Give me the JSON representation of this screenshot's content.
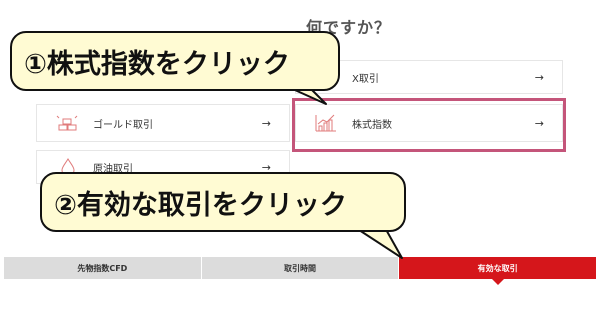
{
  "question": {
    "visible_text": "何ですか？"
  },
  "cards": [
    {
      "key": "fx",
      "label": "X取引",
      "arrow": "→",
      "icon": "fx-icon"
    },
    {
      "key": "gold",
      "label": "ゴールド取引",
      "arrow": "→",
      "icon": "gold-icon"
    },
    {
      "key": "index",
      "label": "株式指数",
      "arrow": "→",
      "icon": "chart-up-icon"
    },
    {
      "key": "crude",
      "label": "原油取引",
      "arrow": "→",
      "icon": "oil-drop-icon"
    }
  ],
  "tabs": [
    {
      "label": "先物指数CFD",
      "active": false
    },
    {
      "label": "取引時間",
      "active": false
    },
    {
      "label": "有効な取引",
      "active": true
    }
  ],
  "callouts": {
    "one": "①株式指数をクリック",
    "two": "②有効な取引をクリック"
  },
  "colors": {
    "highlight": "#c4557a",
    "active_tab": "#d5161b",
    "callout_bg": "#fffbd3"
  }
}
